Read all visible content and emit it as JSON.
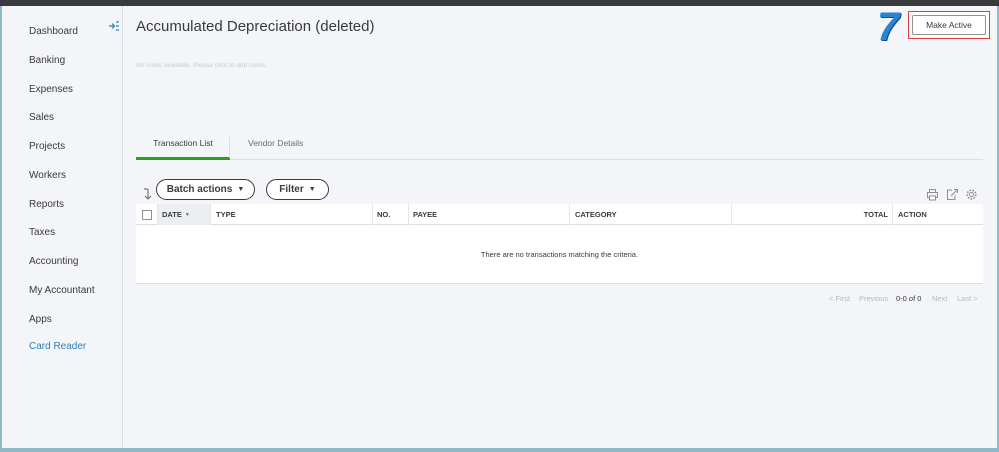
{
  "sidebar": {
    "items": [
      {
        "label": "Dashboard"
      },
      {
        "label": "Banking"
      },
      {
        "label": "Expenses"
      },
      {
        "label": "Sales"
      },
      {
        "label": "Projects"
      },
      {
        "label": "Workers"
      },
      {
        "label": "Reports"
      },
      {
        "label": "Taxes"
      },
      {
        "label": "Accounting"
      },
      {
        "label": "My Accountant"
      },
      {
        "label": "Apps"
      },
      {
        "label": "Card Reader"
      }
    ],
    "accent_color": "#2c82b7"
  },
  "header": {
    "title": "Accumulated Depreciation (deleted)",
    "notes_placeholder": "No notes available. Please click to add notes.",
    "step_number": "7",
    "make_active_label": "Make Active"
  },
  "tabs": [
    {
      "label": "Transaction List",
      "active": true
    },
    {
      "label": "Vendor Details",
      "active": false
    }
  ],
  "toolbar": {
    "batch_actions_label": "Batch actions",
    "filter_label": "Filter",
    "icons": [
      "print-icon",
      "export-icon",
      "settings-icon"
    ]
  },
  "table": {
    "columns": [
      "DATE",
      "TYPE",
      "NO.",
      "PAYEE",
      "CATEGORY",
      "TOTAL",
      "ACTION"
    ],
    "sort_indicator": "▼",
    "empty_message": "There are no transactions matching the criteria."
  },
  "pagination": {
    "first": "< First",
    "previous": "Previous",
    "range": "0-0 of 0",
    "next": "Next",
    "last": "Last >"
  },
  "colors": {
    "active_tab": "#2ca01c",
    "highlight_box": "#e43d3d",
    "step_number": "#2a84d3"
  }
}
